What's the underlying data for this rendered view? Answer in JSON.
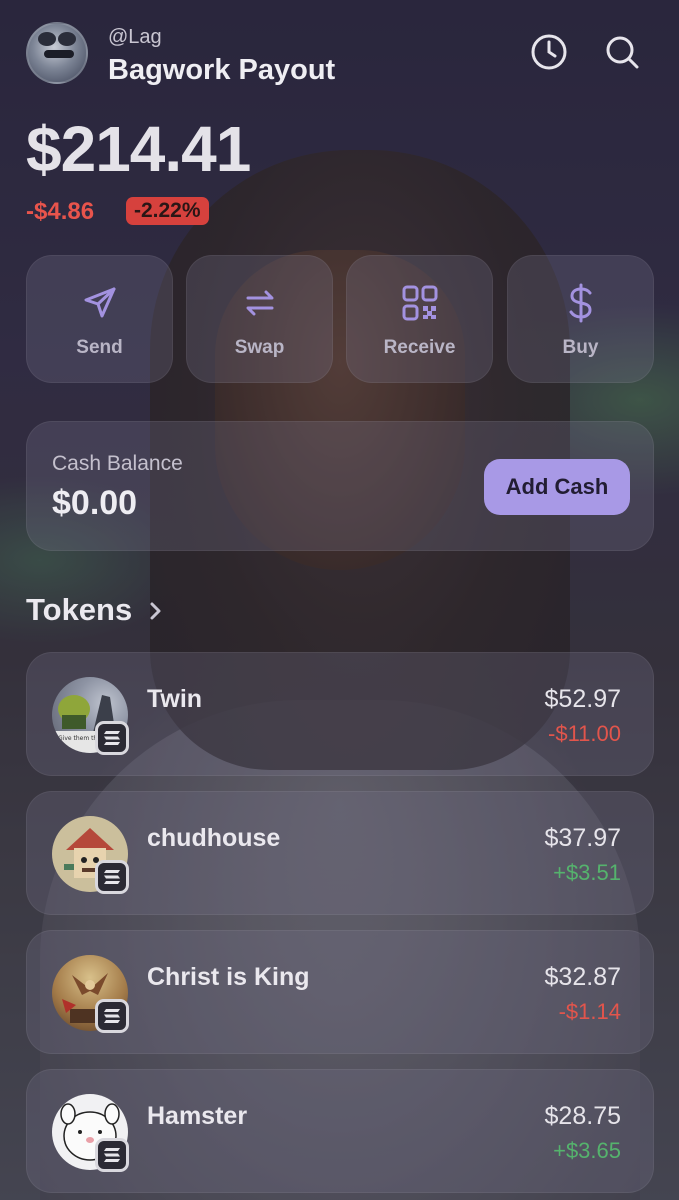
{
  "header": {
    "handle": "@Lag",
    "account_name": "Bagwork Payout",
    "avatar_icon": "avatar-icon",
    "history_icon": "clock-icon",
    "search_icon": "search-icon"
  },
  "portfolio": {
    "balance": "$214.41",
    "change_value": "-$4.86",
    "change_percent": "-2.22%"
  },
  "actions": [
    {
      "label": "Send",
      "icon": "paper-plane-icon"
    },
    {
      "label": "Swap",
      "icon": "swap-arrows-icon"
    },
    {
      "label": "Receive",
      "icon": "qr-code-icon"
    },
    {
      "label": "Buy",
      "icon": "dollar-icon"
    }
  ],
  "cash": {
    "label": "Cash Balance",
    "value": "$0.00",
    "button_label": "Add Cash"
  },
  "tokens": {
    "title": "Tokens",
    "items": [
      {
        "name": "Twin",
        "value": "$52.97",
        "change": "-$11.00",
        "direction": "negative",
        "logo_caption": "Give them that"
      },
      {
        "name": "chudhouse",
        "value": "$37.97",
        "change": "+$3.51",
        "direction": "positive"
      },
      {
        "name": "Christ is King",
        "value": "$32.87",
        "change": "-$1.14",
        "direction": "negative"
      },
      {
        "name": "Hamster",
        "value": "$28.75",
        "change": "+$3.65",
        "direction": "positive"
      }
    ]
  },
  "colors": {
    "accent": "#a899e6",
    "negative": "#e2554c",
    "positive": "#55b36d",
    "icon_purple": "#a392e0"
  }
}
